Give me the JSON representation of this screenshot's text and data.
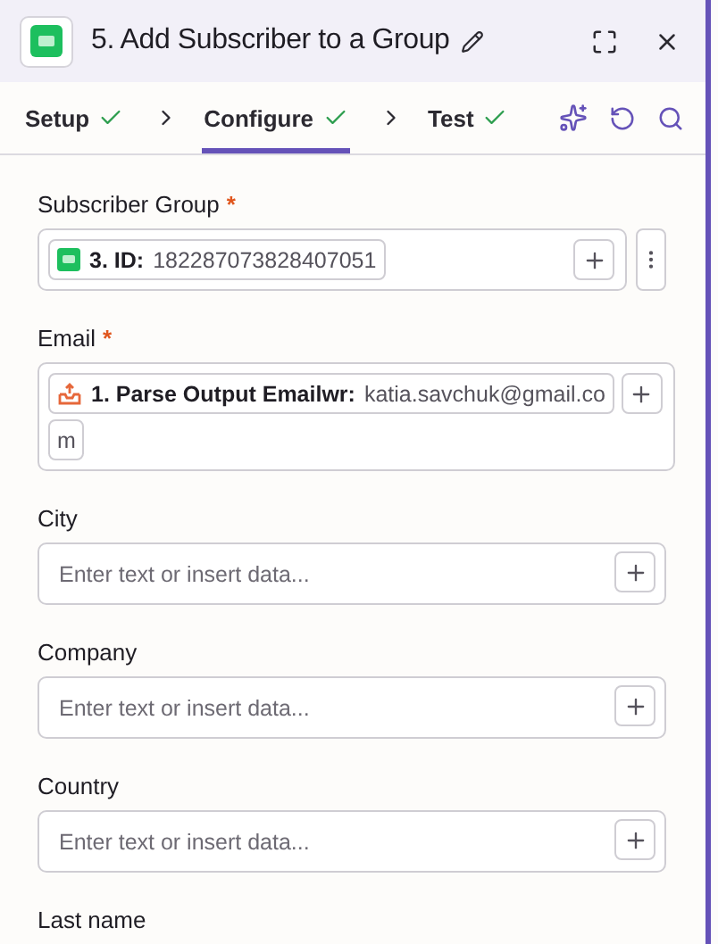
{
  "header": {
    "title": "5. Add Subscriber to a Group"
  },
  "tabs": [
    {
      "label": "Setup",
      "done": true,
      "selected": false
    },
    {
      "label": "Configure",
      "done": true,
      "selected": true
    },
    {
      "label": "Test",
      "done": true,
      "selected": false
    }
  ],
  "fields": [
    {
      "kind": "token",
      "label": "Subscriber Group",
      "mark": "*",
      "menu": true,
      "token": {
        "kind": "chat",
        "label": "3. ID:",
        "value": [
          "182287073828407051"
        ]
      }
    },
    {
      "kind": "token",
      "label": "Email",
      "mark": "*",
      "menu": false,
      "token": {
        "kind": "upload",
        "label": "1. Parse Output Emailwr:",
        "value": [
          "katia.savchuk@gmail.co",
          "m"
        ]
      }
    },
    {
      "kind": "text",
      "label": "City",
      "menu": false,
      "placeholder": "Enter text or insert data..."
    },
    {
      "kind": "text",
      "label": "Company",
      "menu": false,
      "placeholder": "Enter text or insert data..."
    },
    {
      "kind": "text",
      "label": "Country",
      "menu": false,
      "placeholder": "Enter text or insert data..."
    },
    {
      "kind": "label",
      "label": "Last name"
    }
  ]
}
